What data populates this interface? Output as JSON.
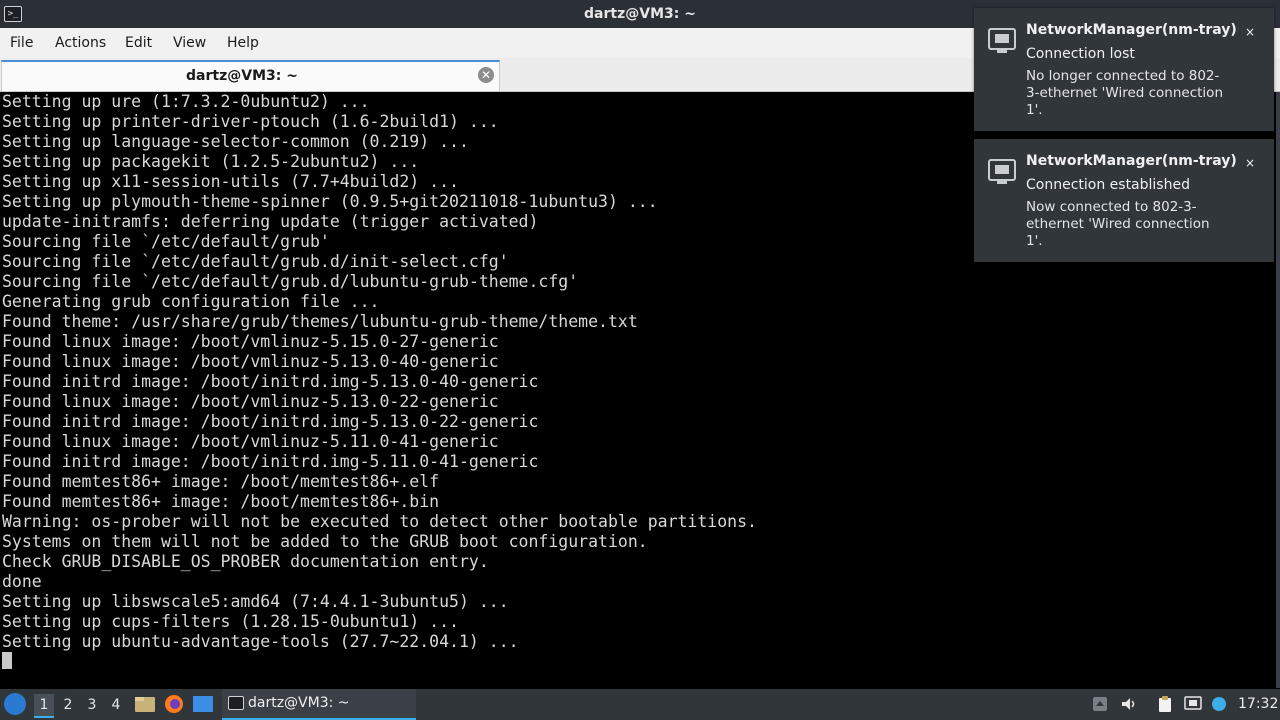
{
  "window": {
    "title": "dartz@VM3: ~"
  },
  "menu": {
    "items": [
      "File",
      "Actions",
      "Edit",
      "View",
      "Help"
    ]
  },
  "tab": {
    "label": "dartz@VM3: ~"
  },
  "terminal": {
    "lines": [
      "Setting up ure (1:7.3.2-0ubuntu2) ...",
      "Setting up printer-driver-ptouch (1.6-2build1) ...",
      "Setting up language-selector-common (0.219) ...",
      "Setting up packagekit (1.2.5-2ubuntu2) ...",
      "Setting up x11-session-utils (7.7+4build2) ...",
      "Setting up plymouth-theme-spinner (0.9.5+git20211018-1ubuntu3) ...",
      "update-initramfs: deferring update (trigger activated)",
      "Sourcing file `/etc/default/grub'",
      "Sourcing file `/etc/default/grub.d/init-select.cfg'",
      "Sourcing file `/etc/default/grub.d/lubuntu-grub-theme.cfg'",
      "Generating grub configuration file ...",
      "Found theme: /usr/share/grub/themes/lubuntu-grub-theme/theme.txt",
      "Found linux image: /boot/vmlinuz-5.15.0-27-generic",
      "Found linux image: /boot/vmlinuz-5.13.0-40-generic",
      "Found initrd image: /boot/initrd.img-5.13.0-40-generic",
      "Found linux image: /boot/vmlinuz-5.13.0-22-generic",
      "Found initrd image: /boot/initrd.img-5.13.0-22-generic",
      "Found linux image: /boot/vmlinuz-5.11.0-41-generic",
      "Found initrd image: /boot/initrd.img-5.11.0-41-generic",
      "Found memtest86+ image: /boot/memtest86+.elf",
      "Found memtest86+ image: /boot/memtest86+.bin",
      "Warning: os-prober will not be executed to detect other bootable partitions.",
      "Systems on them will not be added to the GRUB boot configuration.",
      "Check GRUB_DISABLE_OS_PROBER documentation entry.",
      "done",
      "Setting up libswscale5:amd64 (7:4.4.1-3ubuntu5) ...",
      "Setting up cups-filters (1.28.15-0ubuntu1) ...",
      "Setting up ubuntu-advantage-tools (27.7~22.04.1) ..."
    ]
  },
  "notifications": [
    {
      "app": "NetworkManager(nm-tray)",
      "summary": "Connection lost",
      "body": "No longer connected to 802-3-ethernet 'Wired connection 1'.",
      "icon": "network-wired-icon"
    },
    {
      "app": "NetworkManager(nm-tray)",
      "summary": "Connection established",
      "body": "Now connected to 802-3-ethernet 'Wired connection 1'.",
      "icon": "network-wired-icon"
    }
  ],
  "taskbar": {
    "desktops": [
      "1",
      "2",
      "3",
      "4"
    ],
    "active_desktop": "1",
    "task_label": "dartz@VM3: ~",
    "clock": "17:32"
  },
  "colors": {
    "accent": "#3daee9",
    "panel": "#31363b",
    "terminal_bg": "#000000",
    "terminal_fg": "#d8d8d8"
  }
}
